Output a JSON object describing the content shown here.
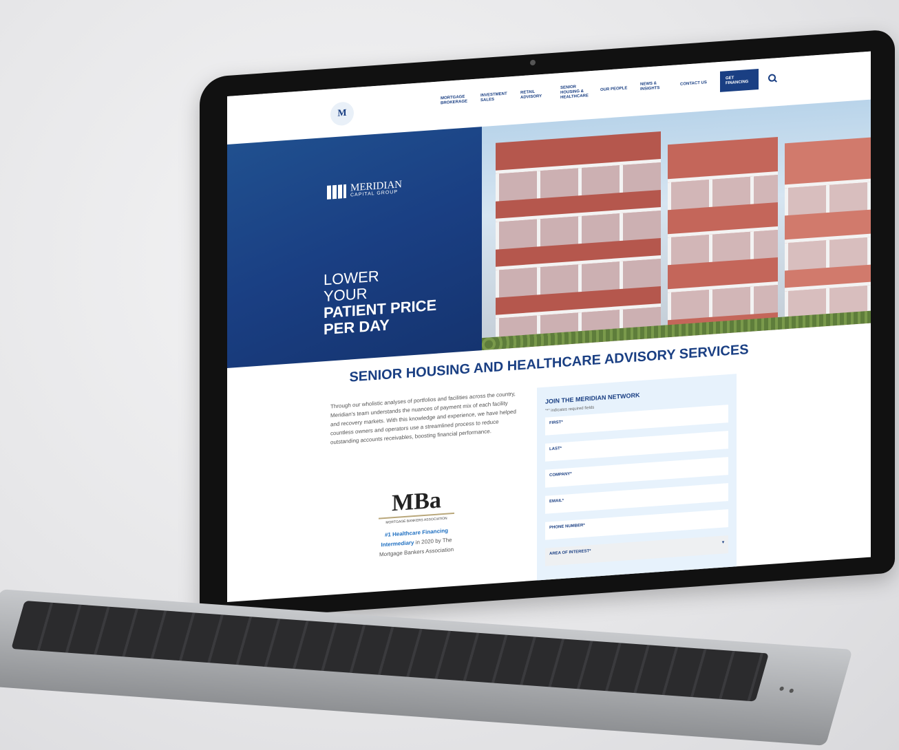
{
  "nav": {
    "items": [
      {
        "label": "MORTGAGE BROKERAGE"
      },
      {
        "label": "INVESTMENT SALES"
      },
      {
        "label": "RETAIL ADVISORY"
      },
      {
        "label": "SENIOR HOUSING & HEALTHCARE"
      },
      {
        "label": "OUR PEOPLE"
      },
      {
        "label": "NEWS & INSIGHTS"
      },
      {
        "label": "CONTACT US"
      }
    ],
    "cta_label": "GET FINANCING",
    "logo_text": "M"
  },
  "hero": {
    "brand_name": "MERIDIAN",
    "brand_sub": "CAPITAL GROUP",
    "line1": "LOWER",
    "line2": "YOUR",
    "line3": "PATIENT PRICE",
    "line4": "PER DAY"
  },
  "section": {
    "title": "SENIOR HOUSING AND HEALTHCARE ADVISORY SERVICES",
    "intro": "Through our wholistic analyses of portfolios and facilities across the country, Meridian's team understands the nuances of payment mix of each facility and recovery markets. With this knowledge and experience, we have helped countless owners and operators use a streamlined process to reduce outstanding accounts receivables, boosting financial performance."
  },
  "mba": {
    "logo": "MBa",
    "sub": "MORTGAGE BANKERS ASSOCIATION",
    "caption_highlight": "#1 Healthcare Financing Intermediary",
    "caption_rest": " in 2020 by The Mortgage Bankers Association"
  },
  "form": {
    "title": "JOIN THE MERIDIAN NETWORK",
    "required_note": "\"*\" indicates required fields",
    "fields": [
      {
        "label": "FIRST*"
      },
      {
        "label": "LAST*"
      },
      {
        "label": "COMPANY*"
      },
      {
        "label": "EMAIL*"
      },
      {
        "label": "PHONE NUMBER*"
      }
    ],
    "select_label": "AREA OF INTEREST*"
  },
  "colors": {
    "brand_blue": "#1a3f83",
    "link_blue": "#1e6fc1",
    "form_bg": "#e7f2fc"
  }
}
